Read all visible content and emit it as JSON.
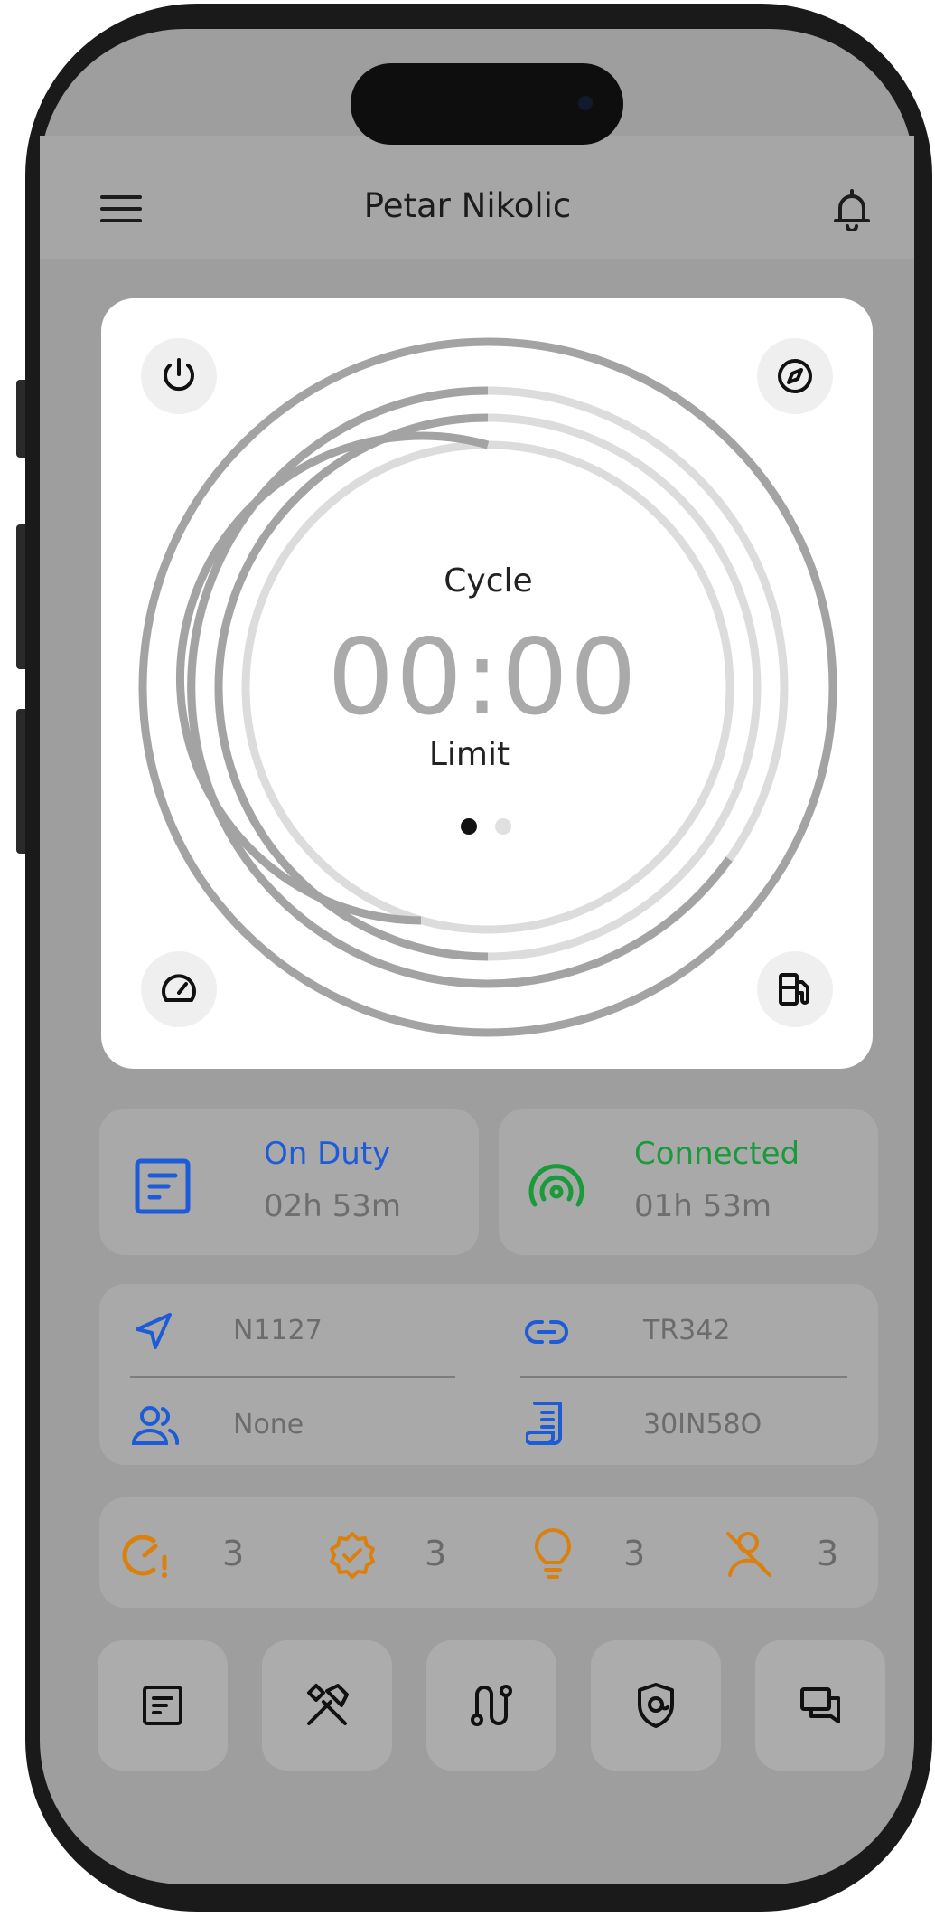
{
  "header": {
    "title": "Petar Nikolic",
    "menu_icon": "hamburger-menu-icon",
    "notification_icon": "bell-icon"
  },
  "clock": {
    "label_top": "Cycle",
    "time": "00:00",
    "label_bottom": "Limit",
    "pages": 2,
    "active_page": 1
  },
  "corners": {
    "top_left": "power-icon",
    "top_right": "compass-icon",
    "bottom_left": "speedometer-icon",
    "bottom_right": "fuel-pump-icon"
  },
  "status": {
    "duty": {
      "title": "On Duty",
      "time": "02h 53m",
      "color": "#1e5bd6"
    },
    "connection": {
      "title": "Connected",
      "time": "01h 53m",
      "color": "#1a9a3a"
    }
  },
  "info": {
    "vehicle": "N1127",
    "trailer": "TR342",
    "co_driver": "None",
    "shipping_doc": "30IN58O"
  },
  "alerts": [
    {
      "icon": "clock-alert-icon",
      "count": "3"
    },
    {
      "icon": "badge-check-icon",
      "count": "3"
    },
    {
      "icon": "lightbulb-icon",
      "count": "3"
    },
    {
      "icon": "user-off-icon",
      "count": "3"
    }
  ],
  "alert_color": "#d9800f",
  "bottom_nav": [
    "logs-icon",
    "tools-icon",
    "route-icon",
    "shield-icon",
    "messages-icon"
  ]
}
